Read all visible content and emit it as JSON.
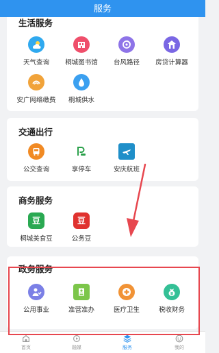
{
  "header": {
    "title": "服务"
  },
  "sections": [
    {
      "title": "生活服务",
      "items": [
        {
          "label": "天气查询",
          "icon": "weather-icon",
          "color": "#2fa9ef"
        },
        {
          "label": "桐城图书馆",
          "icon": "library-icon",
          "color": "#ef4f6b"
        },
        {
          "label": "台风路径",
          "icon": "typhoon-icon",
          "color": "#8e74e8"
        },
        {
          "label": "房贷计算器",
          "icon": "house-calculator-icon",
          "color": "#7a67e4"
        },
        {
          "label": "安广网络缴费",
          "icon": "anguang-network-icon",
          "color": "#f1a33a"
        },
        {
          "label": "桐城供水",
          "icon": "water-drop-icon",
          "color": "#3ba0f0"
        }
      ]
    },
    {
      "title": "交通出行",
      "items": [
        {
          "label": "公交查询",
          "icon": "bus-icon",
          "color": "#f18a24"
        },
        {
          "label": "享停车",
          "icon": "parking-icon",
          "color": "#2aa04a"
        },
        {
          "label": "安庆航班",
          "icon": "airplane-icon",
          "color": "#1f8fc9"
        }
      ]
    },
    {
      "title": "商务服务",
      "items": [
        {
          "label": "桐城美食豆",
          "icon": "food-bean-icon",
          "color": "#2aa952",
          "badge": "豆"
        },
        {
          "label": "公务豆",
          "icon": "official-bean-icon",
          "color": "#e0322f",
          "badge": "豆"
        }
      ]
    },
    {
      "title": "政务服务",
      "items": [
        {
          "label": "公用事业",
          "icon": "public-utility-icon",
          "color": "#7b80e6"
        },
        {
          "label": "准营准办",
          "icon": "business-license-icon",
          "color": "#7cc64a"
        },
        {
          "label": "医疗卫生",
          "icon": "medical-icon",
          "color": "#f19336"
        },
        {
          "label": "税收财务",
          "icon": "tax-finance-icon",
          "color": "#34c096"
        }
      ]
    }
  ],
  "tabs": [
    {
      "label": "首页",
      "icon": "home-icon",
      "active": false
    },
    {
      "label": "融媒",
      "icon": "media-icon",
      "active": false
    },
    {
      "label": "服务",
      "icon": "service-layers-icon",
      "active": true
    },
    {
      "label": "我的",
      "icon": "profile-icon",
      "active": false
    }
  ],
  "annotation": {
    "color": "#e7474f"
  }
}
